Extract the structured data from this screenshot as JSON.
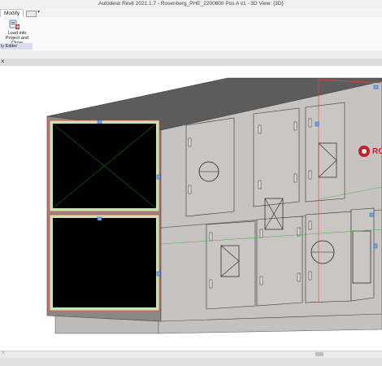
{
  "window": {
    "title": "Autodesk Revit 2021.1.7 - Rosenberg_PHE_2200600 Pos A v1 - 3D View: {3D}"
  },
  "ribbon": {
    "active_tab": "Modify",
    "load_button_label_line1": "Load into",
    "load_button_label_line2": "Project and Close",
    "panel_label": "ly Editor"
  },
  "viewport": {
    "close_glyph": "×",
    "logo_text": "ROS"
  },
  "colors": {
    "housing": "#c6c3c1",
    "housing_top": "#5c5c5c",
    "housing_side": "#8a8886",
    "opening": "#000000",
    "frame": "#c8e2b5",
    "selection": "#ff3c3c",
    "brand": "#c81e28"
  }
}
